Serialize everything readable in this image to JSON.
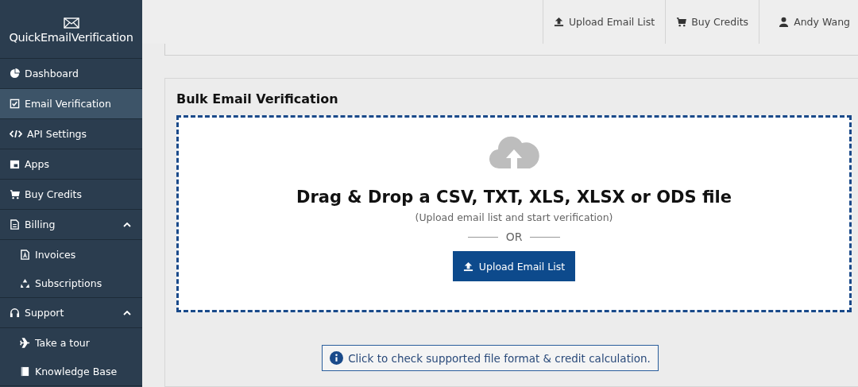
{
  "brand": {
    "name": "QuickEmailVerification"
  },
  "sidebar": {
    "items": [
      {
        "label": "Dashboard",
        "selected": false
      },
      {
        "label": "Email Verification",
        "selected": true
      },
      {
        "label": "API Settings",
        "selected": false
      },
      {
        "label": "Apps",
        "selected": false
      },
      {
        "label": "Buy Credits",
        "selected": false
      },
      {
        "label": "Billing",
        "selected": false,
        "expanded": true,
        "children": [
          {
            "label": "Invoices",
            "selected": false
          },
          {
            "label": "Subscriptions",
            "selected": false
          }
        ]
      },
      {
        "label": "Support",
        "selected": false,
        "expanded": true,
        "children": [
          {
            "label": "Take a tour",
            "selected": false
          },
          {
            "label": "Knowledge Base",
            "selected": false
          }
        ]
      }
    ]
  },
  "topbar": {
    "items": [
      {
        "label": "Upload Email List"
      },
      {
        "label": "Buy Credits"
      },
      {
        "label": "Andy Wang"
      }
    ]
  },
  "panel": {
    "title": "Bulk Email Verification",
    "dropzone": {
      "heading": "Drag & Drop a CSV, TXT, XLS, XLSX or ODS file",
      "subtext": "(Upload email list and start verification)",
      "divider": "OR",
      "button": "Upload Email List"
    },
    "info_link": "Click to check supported file format & credit calculation."
  }
}
